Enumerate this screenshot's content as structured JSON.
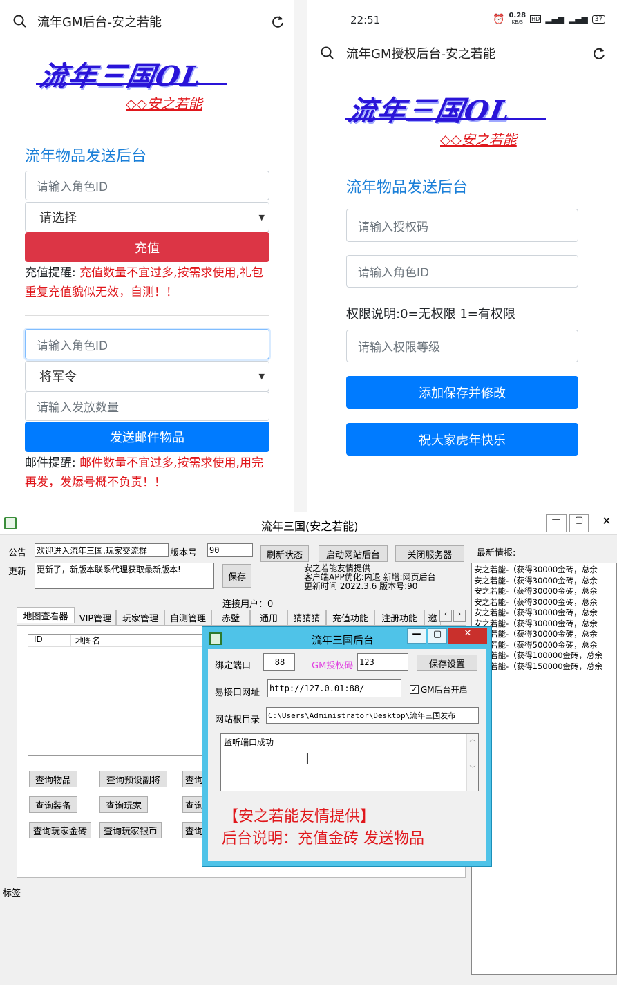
{
  "left_phone": {
    "url": "流年GM后台-安之若能",
    "logo": "流年三国OL",
    "logo_sub": "◇◇安之若能",
    "heading": "流年物品发送后台",
    "role_id_placeholder": "请输入角色ID",
    "select_value": "请选择",
    "recharge_button": "充值",
    "recharge_note_label": "充值提醒: ",
    "recharge_note_text": "充值数量不宜过多,按需求使用,礼包重复充值貌似无效，自测！！",
    "role_id2_placeholder": "请输入角色ID",
    "item_select_value": "将军令",
    "qty_placeholder": "请输入发放数量",
    "mail_button": "发送邮件物品",
    "mail_note_label": "邮件提醒: ",
    "mail_note_text": "邮件数量不宜过多,按需求使用,用完再发，发爆号概不负责！！"
  },
  "right_phone": {
    "status_time": "22:51",
    "status_speed": "0.28",
    "status_speed_unit": "KB/S",
    "status_battery": "37",
    "url": "流年GM授权后台-安之若能",
    "logo": "流年三国OL",
    "logo_sub": "◇◇安之若能",
    "heading": "流年物品发送后台",
    "auth_placeholder": "请输入授权码",
    "role_id_placeholder": "请输入角色ID",
    "perm_note": "权限说明:0=无权限 1=有权限",
    "perm_placeholder": "请输入权限等级",
    "save_button": "添加保存并修改",
    "greet_button": "祝大家虎年快乐"
  },
  "desktop": {
    "title": "流年三国(安之若能)",
    "notice_label": "公告",
    "notice_value": "欢迎进入流年三国,玩家交流群",
    "version_label": "版本号",
    "version_value": "90",
    "refresh_btn": "刷新状态",
    "start_btn": "启动网站后台",
    "close_btn": "关闭服务器",
    "update_label": "更新",
    "update_value": "更新了，新版本联系代理获取最新版本!",
    "save_btn": "保存",
    "info_line1": "安之若能友情提供",
    "info_line2": "客户端APP优化:内退  新增:网页后台",
    "info_line3": "更新时间  2022.3.6   版本号:90",
    "users_label": "连接用户：0",
    "news_label": "最新情报:",
    "news": [
      "安之若能-（获得30000金砖，总余",
      "安之若能-（获得30000金砖，总余",
      "安之若能-（获得30000金砖，总余",
      "安之若能-（获得30000金砖，总余",
      "安之若能-（获得30000金砖，总余",
      "安之若能-（获得30000金砖，总余",
      "安之若能-（获得30000金砖，总余",
      "安之若能-（获得50000金砖，总余",
      "安之若能-（获得100000金砖，总余",
      "安之若能-（获得150000金砖，总余"
    ],
    "tabs": [
      "地图查看器",
      "VIP管理",
      "玩家管理",
      "自测管理",
      "赤壁",
      "通用",
      "猜猜猜",
      "充值功能",
      "注册功能",
      "邀"
    ],
    "col_id": "ID",
    "col_map": "地图名",
    "btns": [
      "查询物品",
      "查询预设副将",
      "查询装备",
      "查询玩家",
      "查询玩家金砖",
      "查询玩家银币"
    ],
    "btn_partial": "查询",
    "bottom_label": "标签",
    "dialog": {
      "title": "流年三国后台",
      "port_label": "绑定端口",
      "port_value": "88",
      "auth_label": "GM授权码",
      "auth_value": "123",
      "save_btn": "保存设置",
      "url_label": "易接口网址",
      "url_value": "http://127.0.01:88/",
      "gm_check": "GM后台开启",
      "root_label": "网站根目录",
      "root_value": "C:\\Users\\Administrator\\Desktop\\流年三国发布",
      "log_text": "监听端口成功",
      "footer1": "【安之若能友情提供】",
      "footer2": "后台说明：充值金砖 发送物品"
    }
  }
}
